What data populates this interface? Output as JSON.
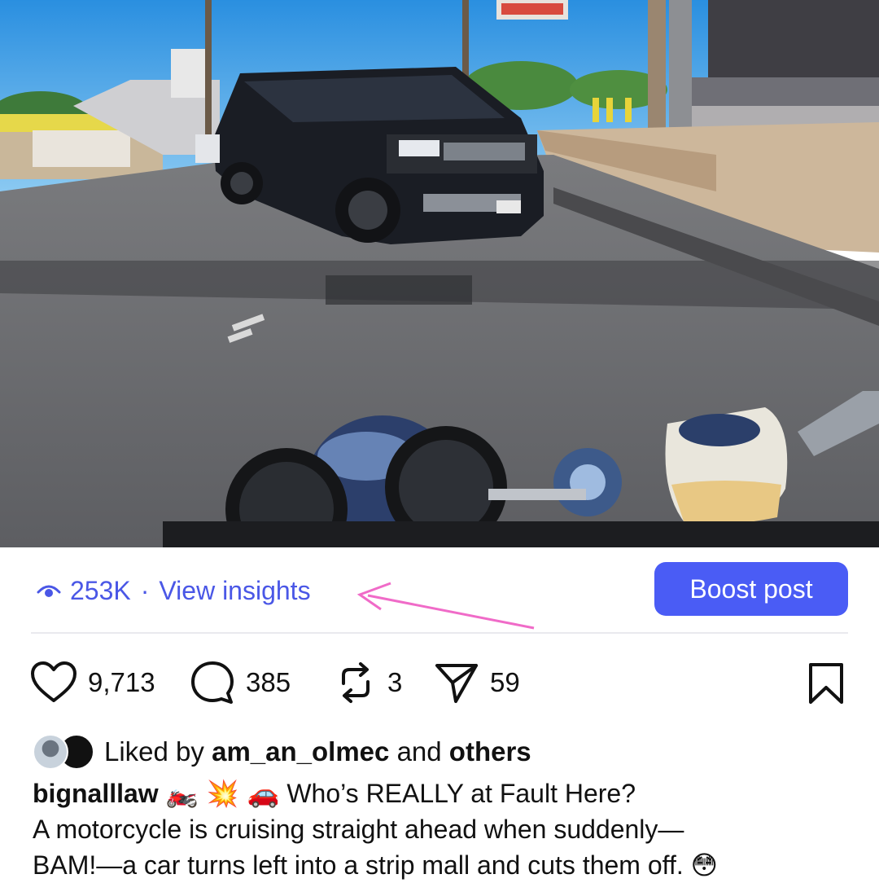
{
  "insights": {
    "views": "253K",
    "separator": "·",
    "link_label": "View insights"
  },
  "boost_button": {
    "label": "Boost post"
  },
  "actions": {
    "likes": "9,713",
    "comments": "385",
    "reposts": "3",
    "shares": "59"
  },
  "liked_by": {
    "prefix": "Liked by",
    "user": "am_an_olmec",
    "conjunction": "and",
    "others": "others"
  },
  "caption": {
    "username": "bignalllaw",
    "emojis": "🏍️ 💥 🚗",
    "headline": "Who’s REALLY at Fault Here?",
    "line2": "A motorcycle is cruising straight ahead when suddenly—",
    "line3": "BAM!—a car turns left into a strip mall and cuts them off.",
    "trailing_emoji": "😳"
  },
  "colors": {
    "accent": "#4a57e6",
    "boost_bg": "#4a5cf5",
    "annotation_arrow": "#f06bc8"
  },
  "icons": [
    "eye-icon",
    "heart-icon",
    "comment-icon",
    "repost-icon",
    "share-icon",
    "bookmark-icon"
  ]
}
